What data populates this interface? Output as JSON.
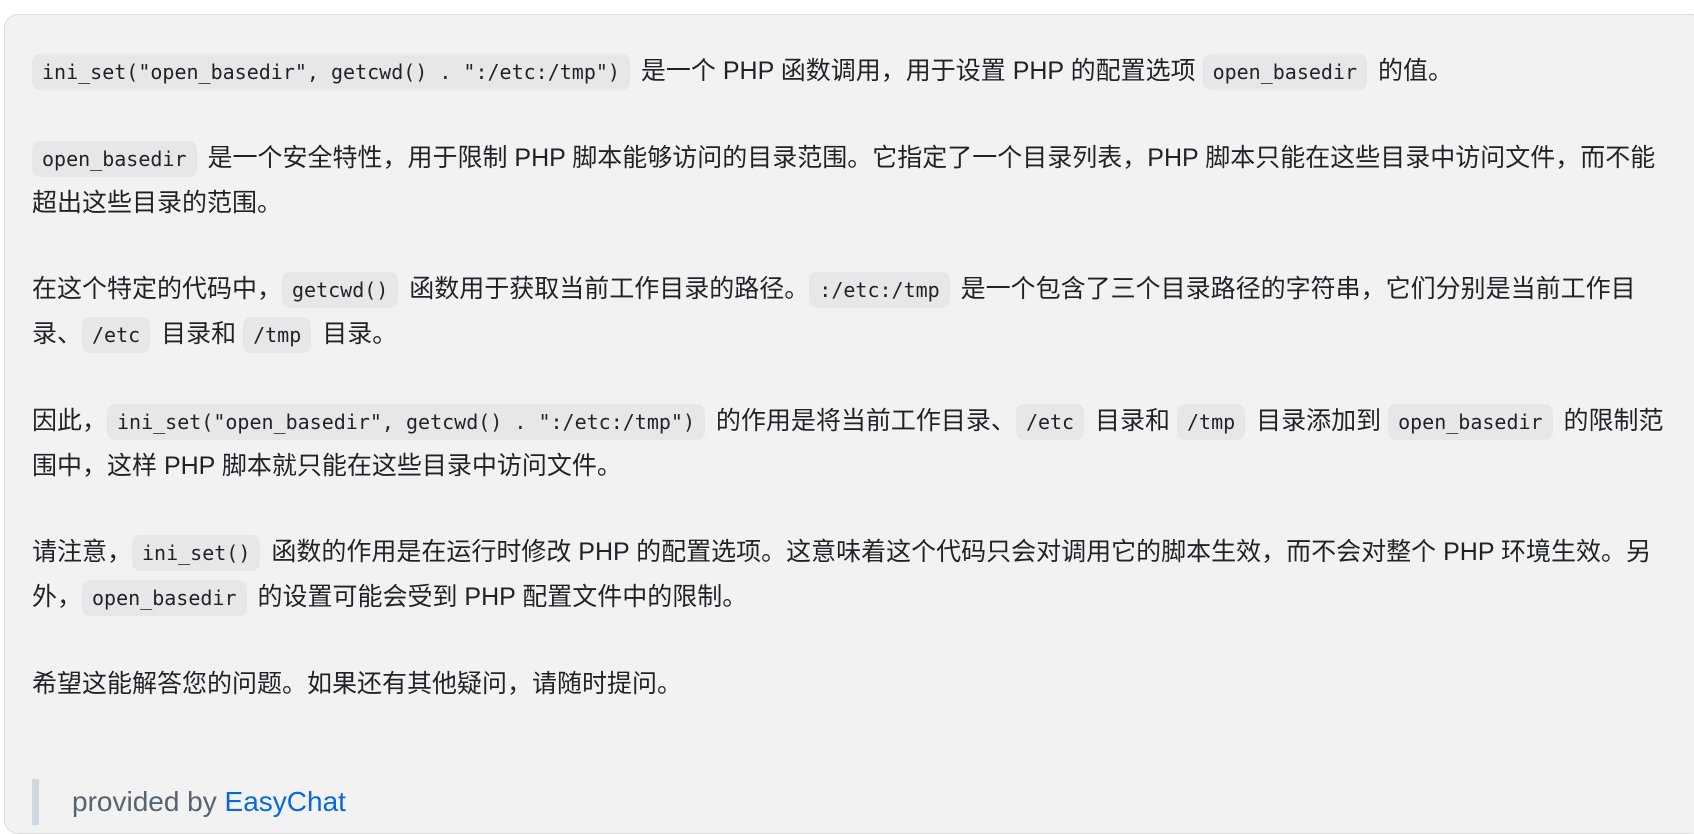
{
  "paragraphs": [
    [
      {
        "c": "ini_set(\"open_basedir\", getcwd() . \":/etc:/tmp\")"
      },
      {
        "t": " 是一个 PHP 函数调用，用于设置 PHP 的配置选项 "
      },
      {
        "c": "open_basedir"
      },
      {
        "t": " 的值。"
      }
    ],
    [
      {
        "c": "open_basedir"
      },
      {
        "t": " 是一个安全特性，用于限制 PHP 脚本能够访问的目录范围。它指定了一个目录列表，PHP 脚本只能在这些目录中访问文件，而不能超出这些目录的范围。"
      }
    ],
    [
      {
        "t": "在这个特定的代码中，"
      },
      {
        "c": "getcwd()"
      },
      {
        "t": " 函数用于获取当前工作目录的路径。"
      },
      {
        "c": ":/etc:/tmp"
      },
      {
        "t": " 是一个包含了三个目录路径的字符串，它们分别是当前工作目录、"
      },
      {
        "c": "/etc"
      },
      {
        "t": " 目录和 "
      },
      {
        "c": "/tmp"
      },
      {
        "t": " 目录。"
      }
    ],
    [
      {
        "t": "因此，"
      },
      {
        "c": "ini_set(\"open_basedir\", getcwd() . \":/etc:/tmp\")"
      },
      {
        "t": " 的作用是将当前工作目录、"
      },
      {
        "c": "/etc"
      },
      {
        "t": " 目录和 "
      },
      {
        "c": "/tmp"
      },
      {
        "t": " 目录添加到 "
      },
      {
        "c": "open_basedir"
      },
      {
        "t": " 的限制范围中，这样 PHP 脚本就只能在这些目录中访问文件。"
      }
    ],
    [
      {
        "t": "请注意，"
      },
      {
        "c": "ini_set()"
      },
      {
        "t": " 函数的作用是在运行时修改 PHP 的配置选项。这意味着这个代码只会对调用它的脚本生效，而不会对整个 PHP 环境生效。另外，"
      },
      {
        "c": "open_basedir"
      },
      {
        "t": " 的设置可能会受到 PHP 配置文件中的限制。"
      }
    ],
    [
      {
        "t": "希望这能解答您的问题。如果还有其他疑问，请随时提问。"
      }
    ]
  ],
  "footer": {
    "prefix": "provided by ",
    "link": "EasyChat"
  },
  "colors": {
    "card_bg": "#f2f2f2",
    "code_bg": "#e6e7e9",
    "link": "#0969da",
    "text": "#1f2328"
  }
}
